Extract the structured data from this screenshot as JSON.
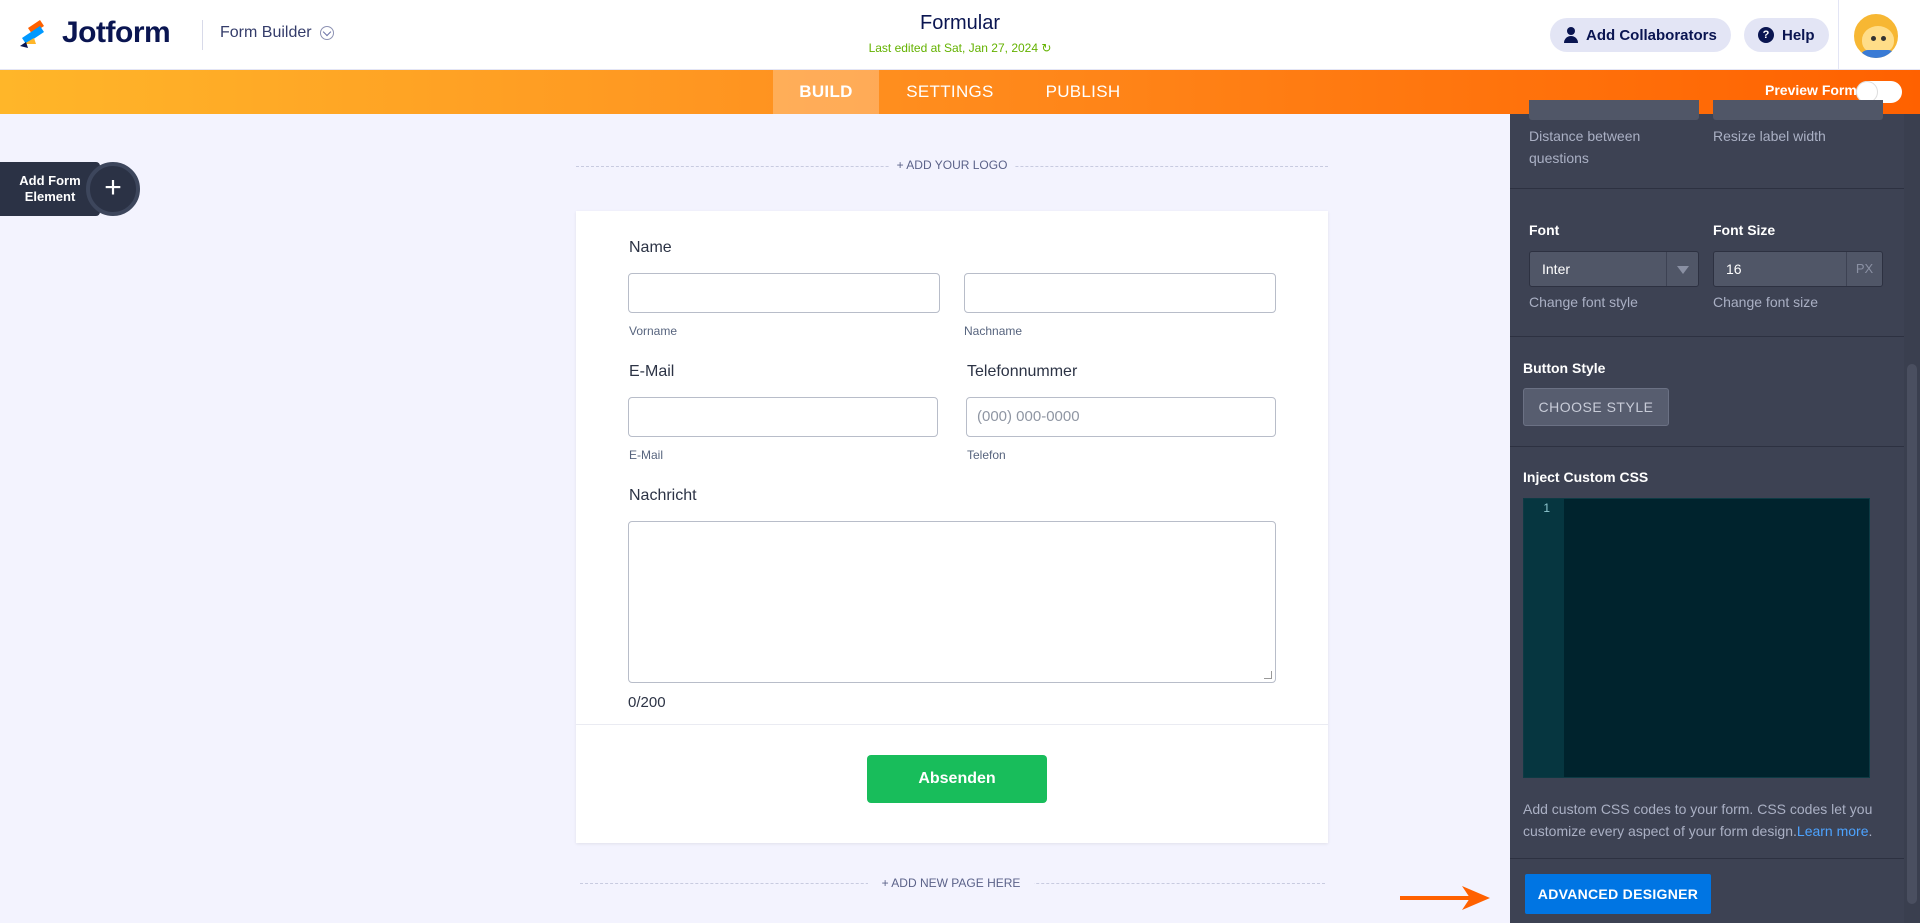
{
  "header": {
    "brand": "Jotform",
    "builder_label": "Form Builder",
    "form_title": "Formular",
    "last_edited": "Last edited at Sat, Jan 27, 2024",
    "collaborators_label": "Add Collaborators",
    "help_label": "Help"
  },
  "nav": {
    "tabs": [
      {
        "label": "BUILD",
        "active": true
      },
      {
        "label": "SETTINGS",
        "active": false
      },
      {
        "label": "PUBLISH",
        "active": false
      }
    ],
    "preview_label": "Preview Form",
    "preview_on": false
  },
  "left": {
    "add_element_line1": "Add Form",
    "add_element_line2": "Element",
    "add_symbol": "+"
  },
  "form": {
    "add_logo": "+ ADD YOUR LOGO",
    "name_label": "Name",
    "first_sub": "Vorname",
    "last_sub": "Nachname",
    "email_label": "E-Mail",
    "email_sub": "E-Mail",
    "phone_label": "Telefonnummer",
    "phone_placeholder": "(000) 000-0000",
    "phone_sub": "Telefon",
    "message_label": "Nachricht",
    "counter": "0/200",
    "submit": "Absenden",
    "add_page": "+ ADD NEW PAGE HERE"
  },
  "panel": {
    "distance_help_line1": "Distance between",
    "distance_help_line2": "questions",
    "label_width_help": "Resize label width",
    "font_label": "Font",
    "font_value": "Inter",
    "font_help": "Change font style",
    "font_size_label": "Font Size",
    "font_size_value": "16",
    "font_size_unit": "PX",
    "font_size_help": "Change font size",
    "button_style_label": "Button Style",
    "choose_style": "CHOOSE STYLE",
    "css_label": "Inject Custom CSS",
    "css_line_no": "1",
    "css_help_line1": "Add custom CSS codes to your form. CSS codes let you",
    "css_help_line2": "customize every aspect of your form design.",
    "learn_more": "Learn more",
    "learn_more_after": ".",
    "advanced": "ADVANCED DESIGNER"
  },
  "colors": {
    "accent_orange": "#ff6100",
    "submit_green": "#18bd5b",
    "advanced_blue": "#0075e3",
    "panel_bg": "#3d4253"
  }
}
